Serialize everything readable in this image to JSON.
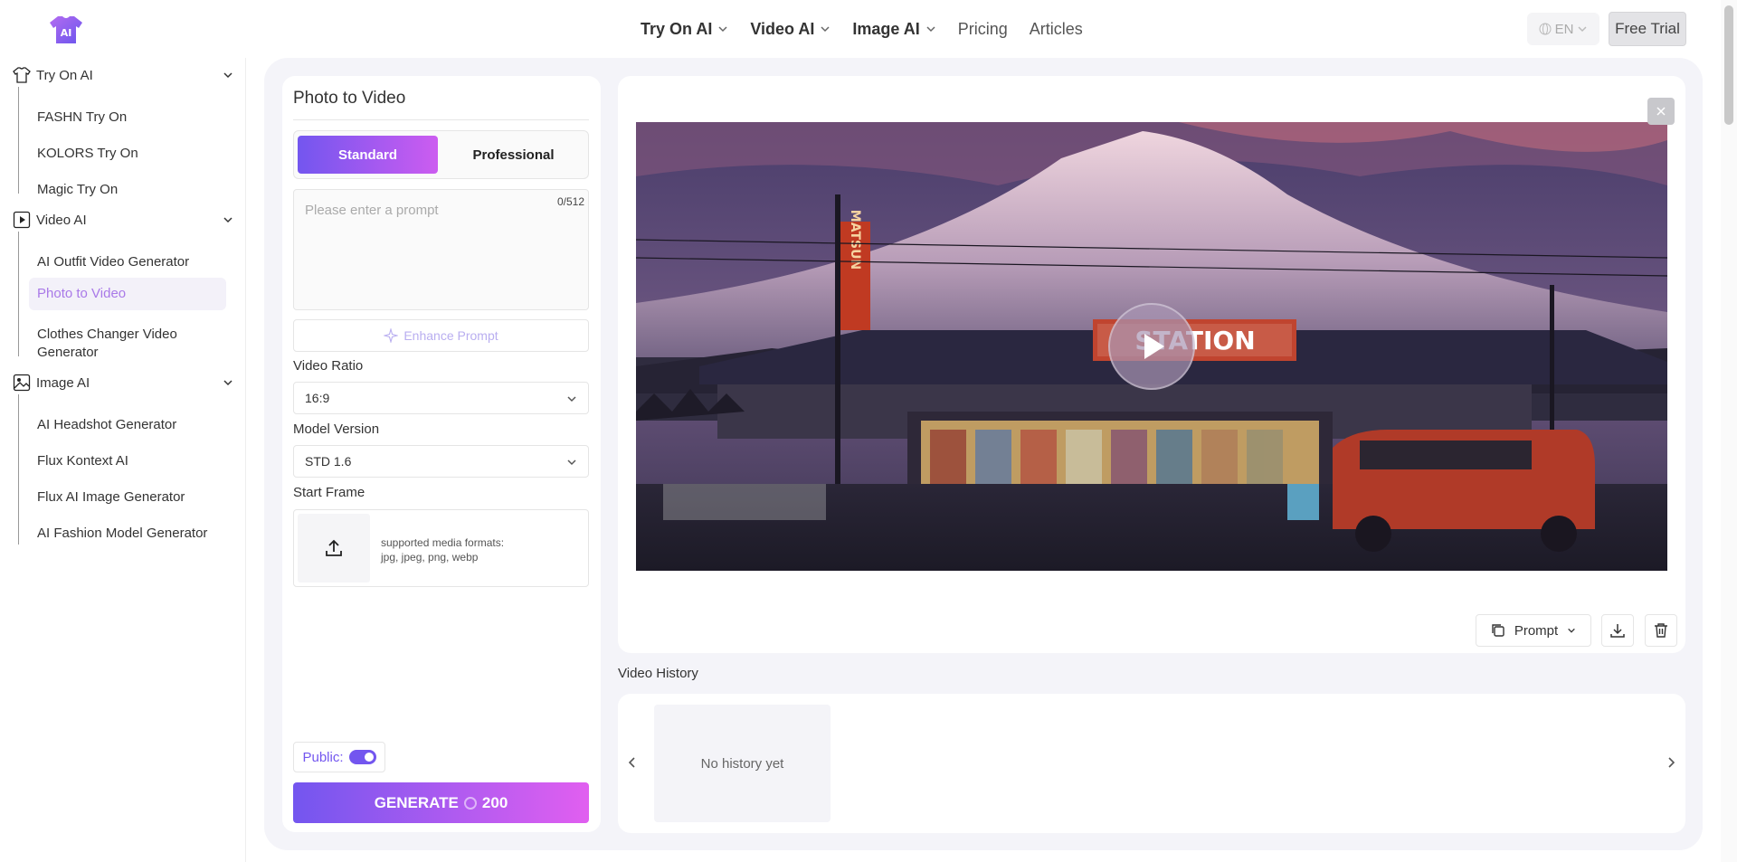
{
  "header": {
    "nav": [
      {
        "label": "Try On AI",
        "dropdown": true
      },
      {
        "label": "Video AI",
        "dropdown": true
      },
      {
        "label": "Image AI",
        "dropdown": true
      },
      {
        "label": "Pricing",
        "dropdown": false
      },
      {
        "label": "Articles",
        "dropdown": false
      }
    ],
    "language": "EN",
    "free_trial": "Free Trial"
  },
  "sidebar": {
    "sections": [
      {
        "title": "Try On AI",
        "icon": "shirt-icon",
        "items": [
          "FASHN Try On",
          "KOLORS Try On",
          "Magic Try On"
        ]
      },
      {
        "title": "Video AI",
        "icon": "video-icon",
        "items": [
          "AI Outfit Video Generator",
          "Photo to Video",
          "Clothes Changer Video Generator"
        ]
      },
      {
        "title": "Image AI",
        "icon": "image-icon",
        "items": [
          "AI Headshot Generator",
          "Flux Kontext AI",
          "Flux AI Image Generator",
          "AI Fashion Model Generator"
        ]
      }
    ],
    "active_item": "Photo to Video"
  },
  "form": {
    "title": "Photo to Video",
    "modes": [
      "Standard",
      "Professional"
    ],
    "selected_mode": "Standard",
    "prompt_placeholder": "Please enter a prompt",
    "prompt_count": "0/512",
    "enhance_label": "Enhance Prompt",
    "ratio_label": "Video Ratio",
    "ratio_value": "16:9",
    "model_label": "Model Version",
    "model_value": "STD 1.6",
    "start_frame_label": "Start Frame",
    "formats_line1": "supported media formats:",
    "formats_line2": "jpg, jpeg, png, webp",
    "public_label": "Public:",
    "public_on": true,
    "generate_label": "GENERATE",
    "generate_cost": "200"
  },
  "preview": {
    "sign_text": "STATION",
    "vertical_sign": "MATSUN",
    "prompt_button": "Prompt"
  },
  "history": {
    "label": "Video History",
    "empty_text": "No history yet"
  },
  "colors": {
    "accent": "#7356ef",
    "accent_end": "#e15ff0",
    "active_text": "#a979e8",
    "panel_bg": "#f4f4f9"
  }
}
